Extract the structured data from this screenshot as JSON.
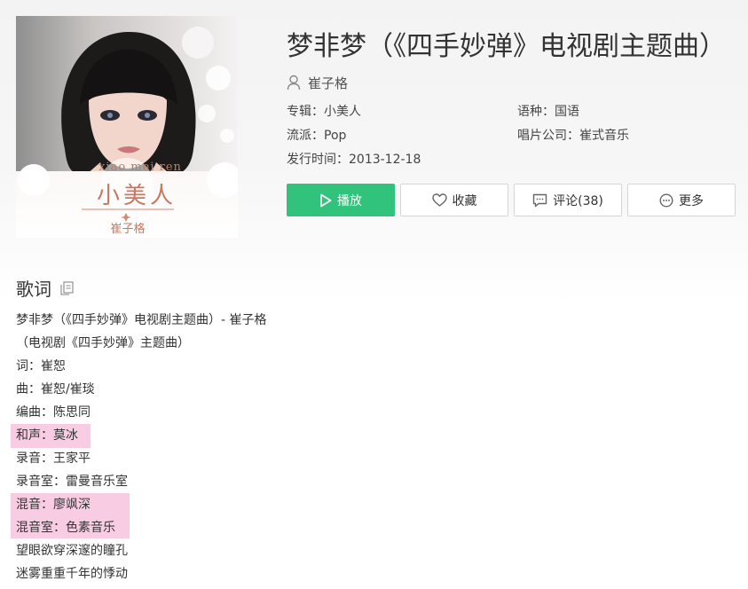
{
  "song": {
    "title": "梦非梦（《四手妙弹》电视剧主题曲）",
    "artist": "崔子格"
  },
  "cover": {
    "pinyin": "xiao mei ren",
    "title": "小美人",
    "artist": "崔子格"
  },
  "meta": {
    "album_label": "专辑：",
    "album_value": "小美人",
    "language_label": "语种：",
    "language_value": "国语",
    "genre_label": "流派：",
    "genre_value": "Pop",
    "company_label": "唱片公司：",
    "company_value": "崔式音乐",
    "release_label": "发行时间：",
    "release_value": "2013-12-18"
  },
  "actions": {
    "play": "播放",
    "favorite": "收藏",
    "comment": "评论(38)",
    "more": "更多"
  },
  "lyrics": {
    "heading": "歌词",
    "lines": [
      "梦非梦（《四手妙弹》电视剧主题曲）- 崔子格",
      "（电视剧《四手妙弹》主题曲）",
      "词：崔恕",
      "曲：崔恕/崔琰",
      "编曲：陈思同",
      "和声：莫冰",
      "录音：王家平",
      "录音室：雷曼音乐室",
      "混音：廖飒深",
      "混音室：色素音乐",
      "望眼欲穿深邃的瞳孔",
      "迷雾重重千年的悸动"
    ]
  },
  "colors": {
    "accent_green": "#31c27c",
    "highlight_pink": "#f8cde4",
    "border_gray": "#d6d6d6"
  },
  "icons": {
    "artist": "person-icon",
    "play": "play-icon",
    "favorite": "heart-icon",
    "comment": "comment-icon",
    "more": "more-icon",
    "copy": "copy-icon"
  }
}
